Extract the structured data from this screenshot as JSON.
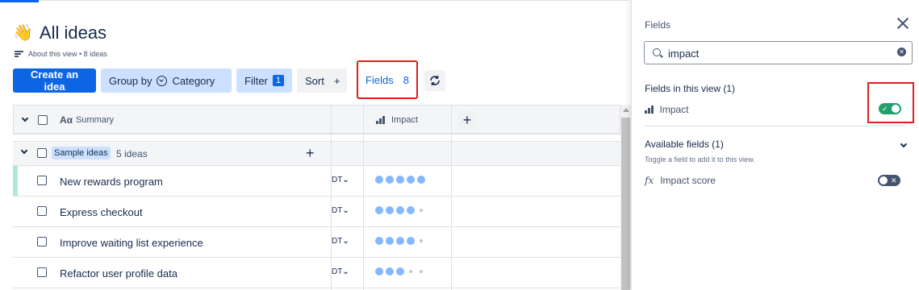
{
  "header": {
    "emoji": "👋",
    "title": "All ideas",
    "meta": "About this view • 8 ideas"
  },
  "toolbar": {
    "create_label": "Create an idea",
    "group_by_label": "Group by",
    "group_by_value": "Category",
    "filter_label": "Filter",
    "filter_count": "1",
    "sort_label": "Sort",
    "sort_plus": "+",
    "fields_label": "Fields",
    "fields_count": "8"
  },
  "table": {
    "summary_header_prefix": "Aα",
    "summary_header": "Summary",
    "impact_header": "Impact",
    "add_column": "+",
    "group": {
      "tag": "Sample ideas",
      "count": "5 ideas",
      "add": "+"
    },
    "rows": [
      {
        "summary": "New rewards program",
        "chip": "DT",
        "impact": 5
      },
      {
        "summary": "Express checkout",
        "chip": "DT",
        "impact": 4
      },
      {
        "summary": "Improve waiting list experience",
        "chip": "DT",
        "impact": 4
      },
      {
        "summary": "Refactor user profile data",
        "chip": "DT",
        "impact": 3
      }
    ],
    "impact_max": 5
  },
  "panel": {
    "title": "Fields",
    "search_value": "impact",
    "in_view_title": "Fields in this view (1)",
    "in_view_field": "Impact",
    "available_title": "Available fields (1)",
    "hint": "Toggle a field to add it to this view.",
    "available_field": "Impact score",
    "fx_symbol": "fx",
    "toggle_on_mark": "✓",
    "toggle_off_mark": "✕"
  },
  "colors": {
    "primary": "#0c66e4",
    "selected_bg": "#cce0ff",
    "toggle_on": "#22a06b",
    "highlight": "#e01e1e",
    "dot": "#85b8ff"
  }
}
